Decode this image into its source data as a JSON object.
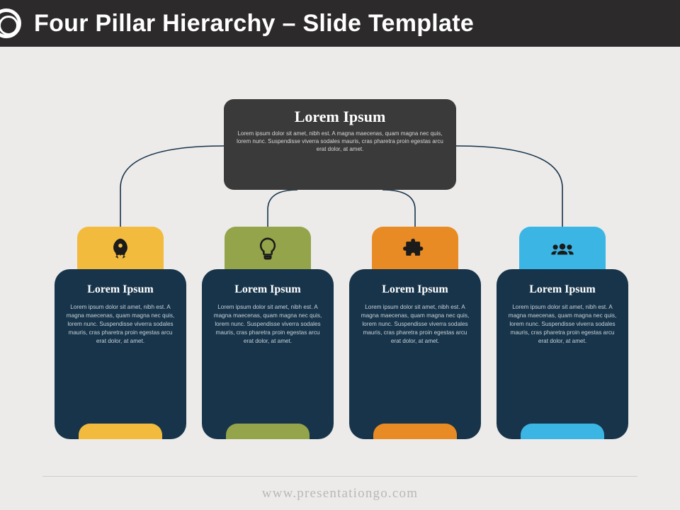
{
  "header": {
    "title": "Four Pillar Hierarchy – Slide Template"
  },
  "top": {
    "title": "Lorem Ipsum",
    "body": "Lorem ipsum dolor sit amet, nibh est. A magna maecenas, quam magna nec quis, lorem nunc. Suspendisse viverra sodales mauris, cras pharetra proin egestas arcu erat dolor, at amet."
  },
  "pillars": [
    {
      "icon": "rocket-icon",
      "color": "c-yellow",
      "title": "Lorem Ipsum",
      "body": "Lorem ipsum dolor sit amet, nibh est. A magna maecenas, quam magna nec quis, lorem nunc. Suspendisse viverra sodales mauris, cras pharetra proin egestas arcu erat dolor, at amet."
    },
    {
      "icon": "bulb-icon",
      "color": "c-green",
      "title": "Lorem Ipsum",
      "body": "Lorem ipsum dolor sit amet, nibh est. A magna maecenas, quam magna nec quis, lorem nunc. Suspendisse viverra sodales mauris, cras pharetra proin egestas arcu erat dolor, at amet."
    },
    {
      "icon": "puzzle-icon",
      "color": "c-orange",
      "title": "Lorem Ipsum",
      "body": "Lorem ipsum dolor sit amet, nibh est. A magna maecenas, quam magna nec quis, lorem nunc. Suspendisse viverra sodales mauris, cras pharetra proin egestas arcu erat dolor, at amet."
    },
    {
      "icon": "people-icon",
      "color": "c-blue",
      "title": "Lorem Ipsum",
      "body": "Lorem ipsum dolor sit amet, nibh est. A magna maecenas, quam magna nec quis, lorem nunc. Suspendisse viverra sodales mauris, cras pharetra proin egestas arcu erat dolor, at amet."
    }
  ],
  "footer": {
    "text": "www.presentationgo.com"
  },
  "colors": {
    "header_bg": "#2d2a2c",
    "card_bg": "#17344a",
    "yellow": "#f2bb3e",
    "green": "#94a44a",
    "orange": "#e88b24",
    "blue": "#3bb6e4"
  }
}
